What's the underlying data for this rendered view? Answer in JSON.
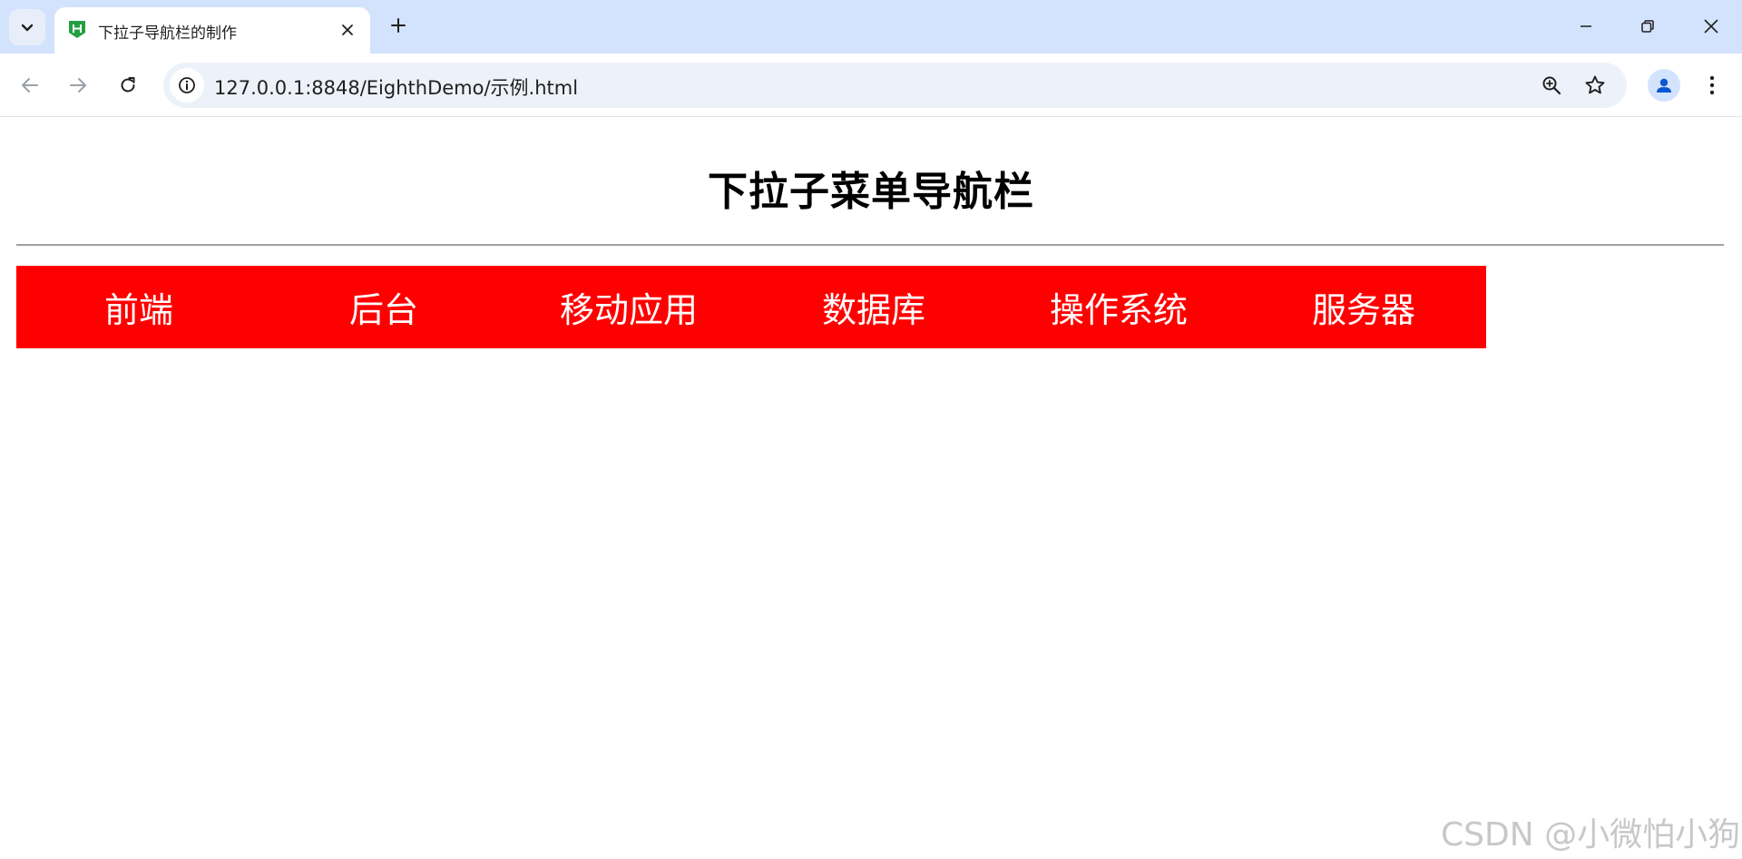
{
  "browser": {
    "tab": {
      "title": "下拉子导航栏的制作"
    },
    "url": "127.0.0.1:8848/EighthDemo/示例.html"
  },
  "page": {
    "title": "下拉子菜单导航栏",
    "nav_items": [
      "前端",
      "后台",
      "移动应用",
      "数据库",
      "操作系统",
      "服务器"
    ]
  },
  "watermark": "CSDN @小微怕小狗",
  "colors": {
    "nav_bg": "#ff0000",
    "tabstrip_bg": "#d3e3fd",
    "favicon": "#23a042"
  }
}
